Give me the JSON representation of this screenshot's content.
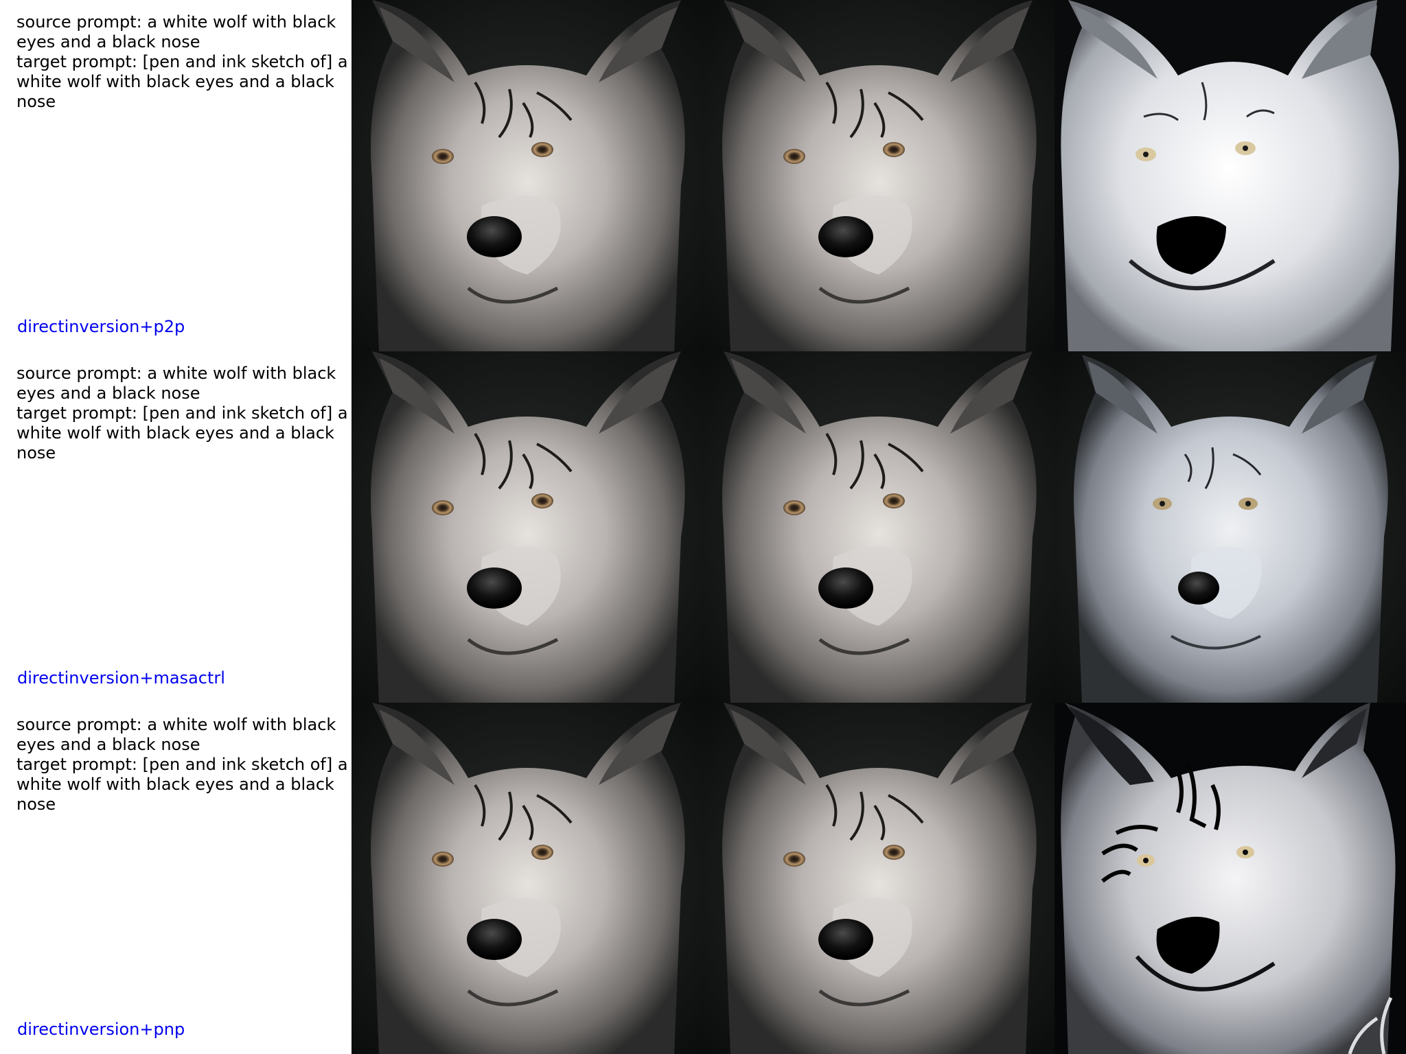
{
  "colors": {
    "prompt_text": "#000000",
    "method_label": "#0000ee",
    "background": "#ffffff"
  },
  "rows": [
    {
      "source_prompt": "source prompt: a white wolf with black eyes and a black nose",
      "target_prompt": "target prompt: [pen and ink sketch of] a white wolf with black eyes and a black nose",
      "method": "directinversion+p2p",
      "images": [
        {
          "subject": "photo of white wolf face (source)",
          "style": "photo"
        },
        {
          "subject": "photo of white wolf face (reconstruction)",
          "style": "photo"
        },
        {
          "subject": "edited white wolf face",
          "style": "smooth-sketch"
        }
      ]
    },
    {
      "source_prompt": "source prompt: a white wolf with black eyes and a black nose",
      "target_prompt": "target prompt: [pen and ink sketch of] a white wolf with black eyes and a black nose",
      "method": "directinversion+masactrl",
      "images": [
        {
          "subject": "photo of white wolf face (source)",
          "style": "photo"
        },
        {
          "subject": "photo of white wolf face (reconstruction)",
          "style": "photo"
        },
        {
          "subject": "edited white wolf face",
          "style": "photo-light"
        }
      ]
    },
    {
      "source_prompt": "source prompt: a white wolf with black eyes and a black nose",
      "target_prompt": "target prompt: [pen and ink sketch of] a white wolf with black eyes and a black nose",
      "method": "directinversion+pnp",
      "images": [
        {
          "subject": "photo of white wolf face (source)",
          "style": "photo"
        },
        {
          "subject": "photo of white wolf face (reconstruction)",
          "style": "photo"
        },
        {
          "subject": "edited white wolf face",
          "style": "ink-sketch"
        }
      ]
    }
  ]
}
